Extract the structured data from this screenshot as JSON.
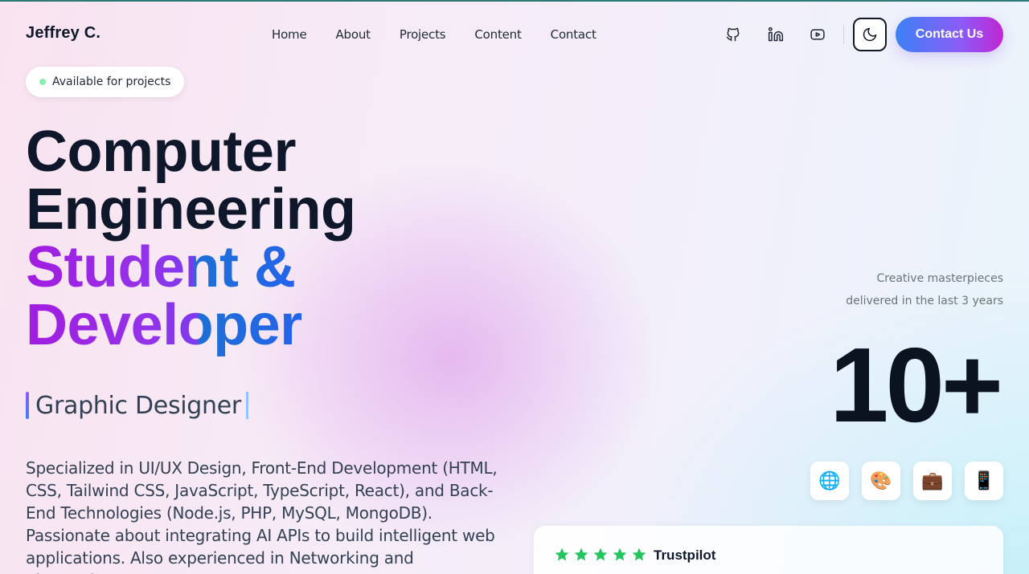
{
  "brand": "Jeffrey C.",
  "nav": {
    "items": [
      "Home",
      "About",
      "Projects",
      "Content",
      "Contact"
    ]
  },
  "social": {
    "icons": [
      "github-icon",
      "linkedin-icon",
      "youtube-icon"
    ]
  },
  "theme_toggle_icon": "moon-icon",
  "contact_button": "Contact Us",
  "availability": "Available for projects",
  "headline": {
    "line1": "Computer",
    "line2": "Engineering",
    "line3": "Student &",
    "line4": "Developer"
  },
  "role": "Graphic Designer",
  "description": "Specialized in UI/UX Design, Front-End Development (HTML, CSS, Tailwind CSS, JavaScript, TypeScript, React), and Back-End Technologies (Node.js, PHP, MySQL, MongoDB). Passionate about integrating AI APIs to build intelligent web applications. Also experienced in Networking and Electronics,",
  "stats": {
    "caption_line1": "Creative masterpieces",
    "caption_line2": "delivered in the last 3 years",
    "value": "10+"
  },
  "chips": [
    "🌐",
    "🎨",
    "💼",
    "📱"
  ],
  "review": {
    "stars": 5,
    "source": "Trustpilot"
  },
  "colors": {
    "accent_start": "#3b82f6",
    "accent_end": "#c026d3",
    "star": "#22c55e",
    "status_dot": "#86efac"
  }
}
